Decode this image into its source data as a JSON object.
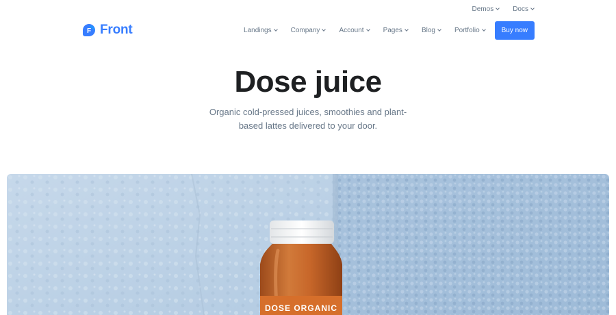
{
  "topbar": {
    "demos_label": "Demos",
    "docs_label": "Docs"
  },
  "brand": {
    "logo_letter": "F",
    "name": "Front"
  },
  "nav": {
    "items": [
      {
        "label": "Landings"
      },
      {
        "label": "Company"
      },
      {
        "label": "Account"
      },
      {
        "label": "Pages"
      },
      {
        "label": "Blog"
      },
      {
        "label": "Portfolio"
      }
    ],
    "cta_label": "Buy now"
  },
  "hero": {
    "title": "Dose juice",
    "subtitle": "Organic cold-pressed juices, smoothies and plant-based lattes delivered to your door."
  },
  "product_image": {
    "label_text": "DOSE ORGANIC"
  },
  "colors": {
    "accent": "#377dff",
    "muted_text": "#677788",
    "heading": "#1e2022",
    "wall": "#b9cfe4",
    "juice": "#c8672a"
  },
  "icons": {
    "dropdown": "chevron-down-icon",
    "logo": "front-logo-icon"
  }
}
